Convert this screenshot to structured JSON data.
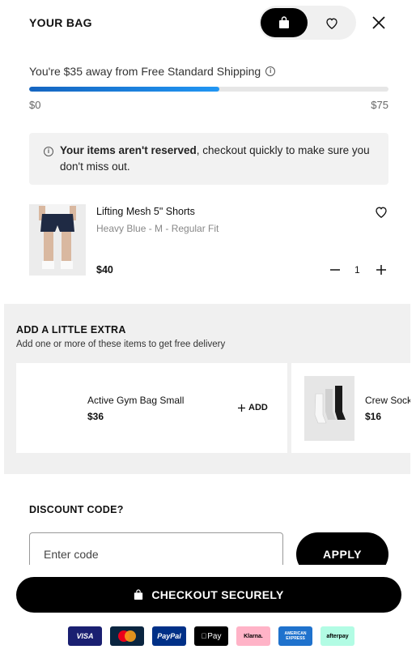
{
  "header": {
    "title": "YOUR BAG",
    "bag_icon": "shopping-bag-icon",
    "wishlist_icon": "heart-icon",
    "close_icon": "close-icon"
  },
  "shipping": {
    "message": "You're $35 away from Free Standard Shipping",
    "progress_fraction": 0.53,
    "min_label": "$0",
    "max_label": "$75",
    "accent_color": "#1e88e5"
  },
  "notice": {
    "bold_text": "Your items aren't reserved",
    "text": ", checkout quickly to make sure you don't miss out."
  },
  "cart_item": {
    "name": "Lifting Mesh 5\" Shorts",
    "variant": "Heavy Blue - M - Regular Fit",
    "price": "$40",
    "quantity": "1"
  },
  "extras": {
    "title": "ADD A LITTLE EXTRA",
    "subtitle": "Add one or more of these items to get free delivery",
    "items": [
      {
        "name": "Active Gym Bag Small",
        "price": "$36",
        "add_label": "ADD"
      },
      {
        "name": "Crew Socks",
        "price": "$16"
      }
    ]
  },
  "discount": {
    "title": "DISCOUNT CODE?",
    "placeholder": "Enter code",
    "apply_label": "APPLY"
  },
  "checkout": {
    "label": "CHECKOUT SECURELY"
  },
  "payment_methods": [
    {
      "label": "VISA",
      "bg": "#1a1f71",
      "fg": "#ffffff"
    },
    {
      "label": "",
      "bg": "#0a2540",
      "fg": "#ffffff"
    },
    {
      "label": "PayPal",
      "bg": "#003087",
      "fg": "#ffffff"
    },
    {
      "label": "Pay",
      "bg": "#000000",
      "fg": "#ffffff"
    },
    {
      "label": "Klarna.",
      "bg": "#ffb3c7",
      "fg": "#000000"
    },
    {
      "label": "AMERICAN EXPRESS",
      "bg": "#1f72cd",
      "fg": "#ffffff"
    },
    {
      "label": "afterpay",
      "bg": "#b2fce4",
      "fg": "#000000"
    }
  ]
}
